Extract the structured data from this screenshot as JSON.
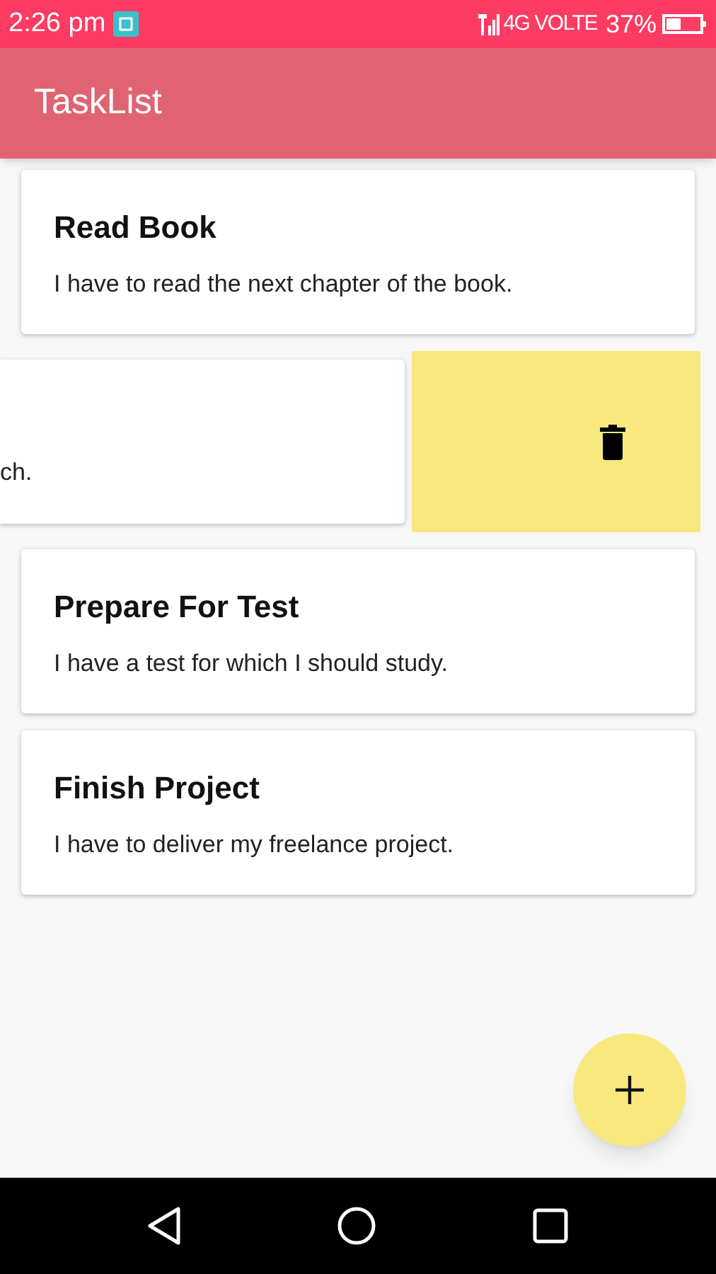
{
  "status_bar": {
    "time": "2:26 pm",
    "network": "4G VOLTE",
    "battery": "37%"
  },
  "app_bar": {
    "title": "TaskList"
  },
  "tasks": [
    {
      "kind": "card",
      "title": "Read Book",
      "description": "I have to read the next chapter of the book."
    },
    {
      "kind": "swiped",
      "description": "ch."
    },
    {
      "kind": "card",
      "title": "Prepare For Test",
      "description": "I have a test for which I should study."
    },
    {
      "kind": "card",
      "title": "Finish Project",
      "description": "I have to deliver my freelance project."
    }
  ]
}
